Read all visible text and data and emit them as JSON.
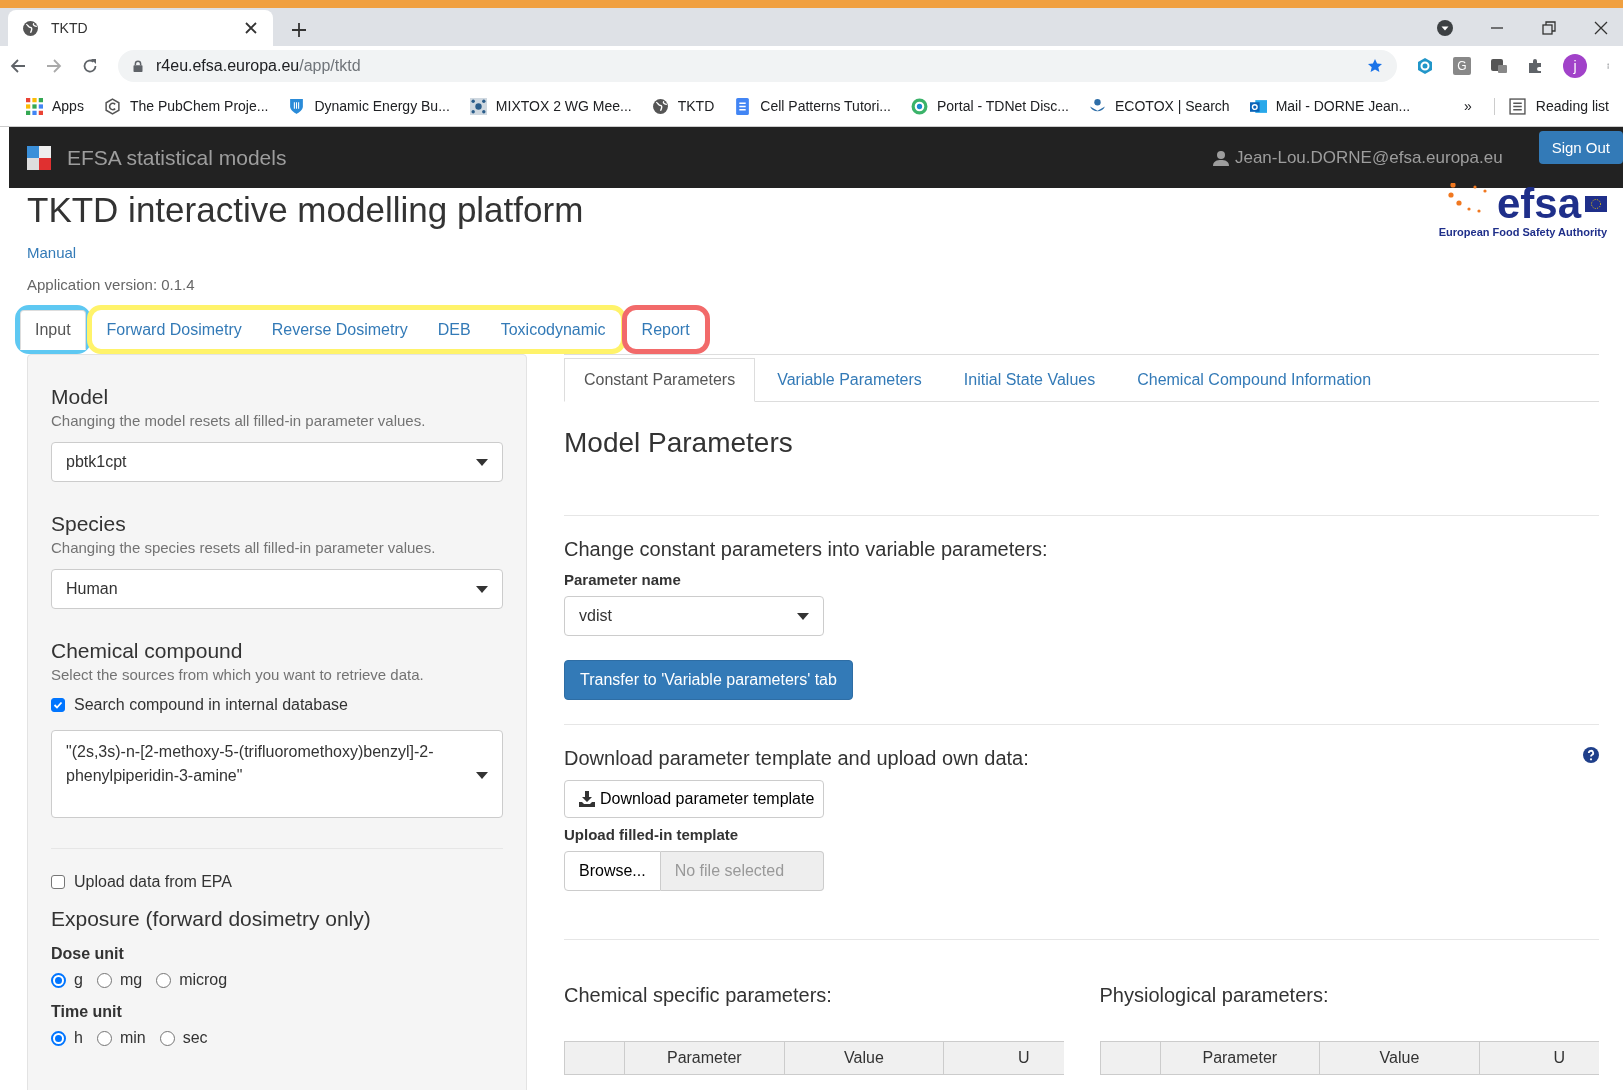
{
  "browser": {
    "tab_title": "TKTD",
    "url_host": "r4eu.efsa.europa.eu",
    "url_path": "/app/tktd",
    "extension_letter": "G",
    "profile_initial": "j",
    "bookmarks": [
      {
        "label": "Apps",
        "kind": "apps"
      },
      {
        "label": "The PubChem Proje...",
        "kind": "pubchem"
      },
      {
        "label": "Dynamic Energy Bu...",
        "kind": "shield"
      },
      {
        "label": "MIXTOX 2 WG Mee...",
        "kind": "network"
      },
      {
        "label": "TKTD",
        "kind": "globe"
      },
      {
        "label": "Cell Patterns Tutori...",
        "kind": "doc"
      },
      {
        "label": "Portal - TDNet Disc...",
        "kind": "ring"
      },
      {
        "label": "ECOTOX | Search",
        "kind": "ecotox"
      },
      {
        "label": "Mail - DORNE Jean...",
        "kind": "mail"
      }
    ],
    "overflow": "»",
    "reading_list": "Reading list"
  },
  "navbar": {
    "brand": "EFSA statistical models",
    "user": "Jean-Lou.DORNE@efsa.europa.eu",
    "sign_out": "Sign Out"
  },
  "header": {
    "title": "TKTD interactive modelling platform",
    "manual_link": "Manual",
    "version": "Application version: 0.1.4",
    "logo": {
      "wordmark": "efsa",
      "tagline": "European Food Safety Authority"
    }
  },
  "main_tabs": [
    {
      "label": "Input",
      "selected": true,
      "color": "#5ec8f2"
    },
    {
      "label": "Forward Dosimetry",
      "selected": false,
      "color": "#fff36a"
    },
    {
      "label": "Reverse Dosimetry",
      "selected": false,
      "color": "#fff36a"
    },
    {
      "label": "DEB",
      "selected": false,
      "color": "#fff36a"
    },
    {
      "label": "Toxicodynamic",
      "selected": false,
      "color": "#fff36a"
    },
    {
      "label": "Report",
      "selected": false,
      "color": "#f26a6a"
    }
  ],
  "input_panel": {
    "sections": [
      {
        "kind": "select",
        "heading": "Model",
        "hint": "Changing the model resets all filled-in parameter values.",
        "value": "pbtk1cpt"
      },
      {
        "kind": "select",
        "heading": "Species",
        "hint": "Changing the species resets all filled-in parameter values.",
        "value": "Human"
      },
      {
        "kind": "compound",
        "heading": "Chemical compound",
        "hint": "Select the sources from which you want to retrieve data.",
        "checkbox": {
          "label": "Search compound in internal database",
          "checked": true
        },
        "value": "\"(2s,3s)-n-[2-methoxy-5-(trifluoromethoxy)benzyl]-2-phenylpiperidin-3-amine\""
      },
      {
        "kind": "divider"
      },
      {
        "kind": "checkbox",
        "label": "Upload data from EPA",
        "checked": false
      },
      {
        "kind": "exposure",
        "heading": "Exposure (forward dosimetry only)",
        "groups": [
          {
            "label": "Dose unit",
            "options": [
              {
                "label": "g",
                "selected": true
              },
              {
                "label": "mg",
                "selected": false
              },
              {
                "label": "microg",
                "selected": false
              }
            ]
          },
          {
            "label": "Time unit",
            "options": [
              {
                "label": "h",
                "selected": true
              },
              {
                "label": "min",
                "selected": false
              },
              {
                "label": "sec",
                "selected": false
              }
            ]
          }
        ]
      }
    ]
  },
  "sub_tabs": [
    {
      "label": "Constant Parameters",
      "selected": true
    },
    {
      "label": "Variable Parameters",
      "selected": false
    },
    {
      "label": "Initial State Values",
      "selected": false
    },
    {
      "label": "Chemical Compound Information",
      "selected": false
    }
  ],
  "parameters": {
    "title": "Model Parameters",
    "convert": {
      "heading": "Change constant parameters into variable parameters:",
      "field_label": "Parameter name",
      "value": "vdist",
      "button": "Transfer to 'Variable parameters' tab"
    },
    "template": {
      "heading": "Download parameter template and upload own data:",
      "download_button": "Download parameter template",
      "upload_label": "Upload filled-in template",
      "browse_button": "Browse...",
      "placeholder": "No file selected"
    },
    "tables": [
      {
        "title": "Chemical specific parameters:",
        "columns": [
          "Parameter",
          "Value",
          "U"
        ]
      },
      {
        "title": "Physiological parameters:",
        "columns": [
          "Parameter",
          "Value",
          "U"
        ]
      }
    ]
  }
}
